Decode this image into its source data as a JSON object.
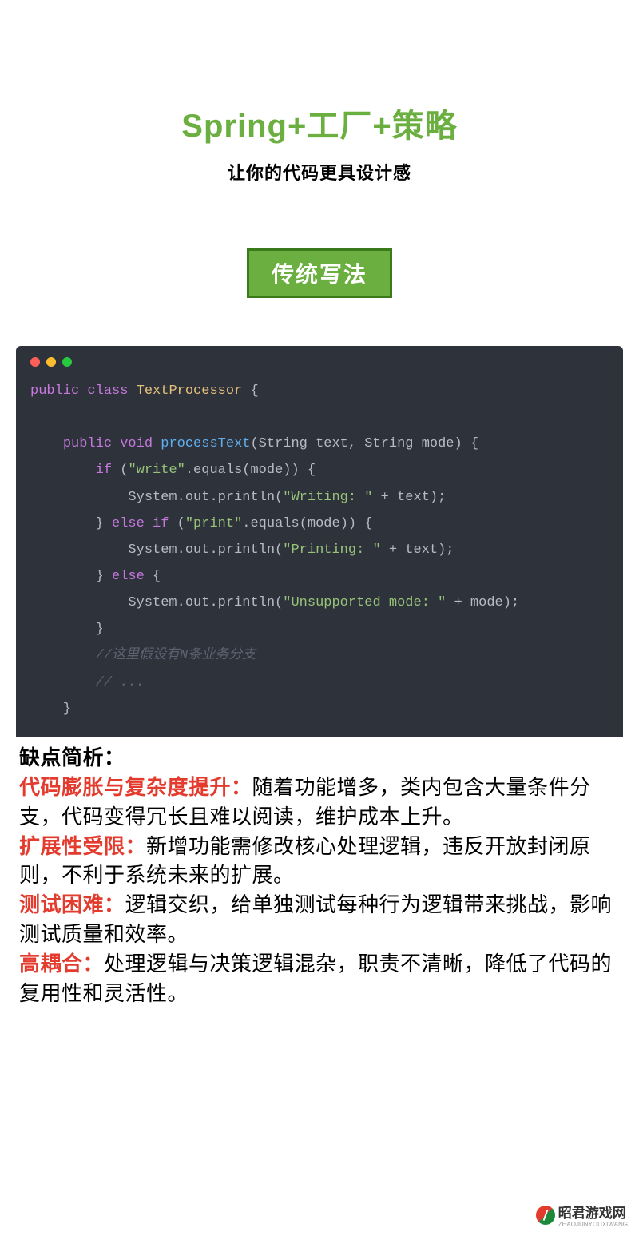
{
  "title": "Spring+工厂+策略",
  "subtitle": "让你的代码更具设计感",
  "badge": "传统写法",
  "code": {
    "l1a": "public",
    "l1b": "class",
    "l1c": "TextProcessor",
    "l1d": " {",
    "l2a": "public",
    "l2b": "void",
    "l2c": "processText",
    "l2d": "(String text, String mode) {",
    "l3a": "if",
    "l3b": " (",
    "l3c": "\"write\"",
    "l3d": ".equals(mode)) {",
    "l4a": "System.out.println(",
    "l4b": "\"Writing: \"",
    "l4c": " + text);",
    "l5a": "} ",
    "l5b": "else if",
    "l5c": " (",
    "l5d": "\"print\"",
    "l5e": ".equals(mode)) {",
    "l6a": "System.out.println(",
    "l6b": "\"Printing: \"",
    "l6c": " + text);",
    "l7a": "} ",
    "l7b": "else",
    "l7c": " {",
    "l8a": "System.out.println(",
    "l8b": "\"Unsupported mode: \"",
    "l8c": " + mode);",
    "l9": "}",
    "l10": "//这里假设有N条业务分支",
    "l11": "// ...",
    "l12": "}"
  },
  "analysis": {
    "header": "缺点简析：",
    "p1h": "代码膨胀与复杂度提升：",
    "p1": "随着功能增多，类内包含大量条件分支，代码变得冗长且难以阅读，维护成本上升。",
    "p2h": "扩展性受限：",
    "p2": "新增功能需修改核心处理逻辑，违反开放封闭原则，不利于系统未来的扩展。",
    "p3h": "测试困难：",
    "p3": "逻辑交织，给单独测试每种行为逻辑带来挑战，影响测试质量和效率。",
    "p4h": "高耦合：",
    "p4": "处理逻辑与决策逻辑混杂，职责不清晰，降低了代码的复用性和灵活性。"
  },
  "watermark": {
    "cn": "昭君游戏网",
    "py": "ZHAOJUNYOUXIWANG"
  }
}
